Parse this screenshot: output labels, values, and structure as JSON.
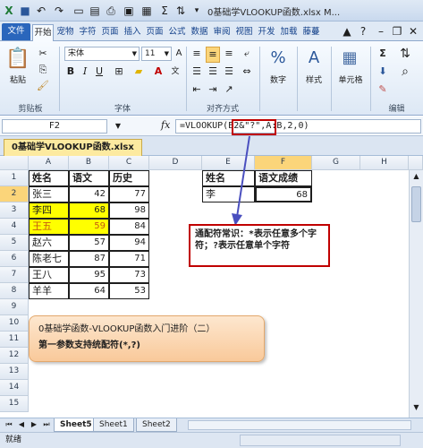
{
  "window": {
    "title": "0基础学VLOOKUP函数.xlsx M..."
  },
  "ribbon": {
    "tabs": [
      "文件",
      "开始",
      "宠物",
      "字符",
      "页面",
      "插入",
      "页面",
      "公式",
      "数据",
      "审阅",
      "视图",
      "开发",
      "加载",
      "藤蔓"
    ],
    "clipboard": {
      "paste": "粘贴",
      "group": "剪贴板"
    },
    "font": {
      "name": "宋体",
      "size": "11",
      "group": "字体"
    },
    "alignment": {
      "group": "对齐方式"
    },
    "number": {
      "label": "数字"
    },
    "styles": {
      "label": "样式"
    },
    "cells": {
      "label": "单元格"
    },
    "editing": {
      "group": "编辑"
    }
  },
  "formula_bar": {
    "name_box": "F2",
    "fx": "fx",
    "formula": "=VLOOKUP(E2&\"?\",A:B,2,0)"
  },
  "workbook_tab": "0基础学VLOOKUP函数.xlsx",
  "grid": {
    "columns": [
      "A",
      "B",
      "C",
      "D",
      "E",
      "F",
      "G",
      "H"
    ],
    "rows": [
      "1",
      "2",
      "3",
      "4",
      "5",
      "6",
      "7",
      "8",
      "9",
      "10",
      "11",
      "12",
      "13",
      "14",
      "15"
    ],
    "table1": {
      "headers": [
        "姓名",
        "语文",
        "历史"
      ],
      "rows": [
        [
          "张三",
          "42",
          "77"
        ],
        [
          "李四",
          "68",
          "98"
        ],
        [
          "王五",
          "59",
          "84"
        ],
        [
          "赵六",
          "57",
          "94"
        ],
        [
          "陈老七",
          "87",
          "71"
        ],
        [
          "王八",
          "95",
          "73"
        ],
        [
          "羊羊",
          "64",
          "53"
        ]
      ]
    },
    "table2": {
      "headers": [
        "姓名",
        "语文成绩"
      ],
      "row": [
        "李",
        "68"
      ]
    }
  },
  "callout_red": "通配符常识：*表示任意多个字符；?表示任意单个字符",
  "callout_orange": {
    "line1": "0基础学函数-VLOOKUP函数入门进阶（二）",
    "line2": "第一参数支持统配符(*,?)"
  },
  "sheets": [
    "Sheet5",
    "Sheet1",
    "Sheet2"
  ],
  "status": "就绪",
  "colors": {
    "highlight": "#ffff00",
    "callout_border": "#c00000",
    "arrow": "#4a4fbf",
    "file_tab": "#2a66bc"
  }
}
